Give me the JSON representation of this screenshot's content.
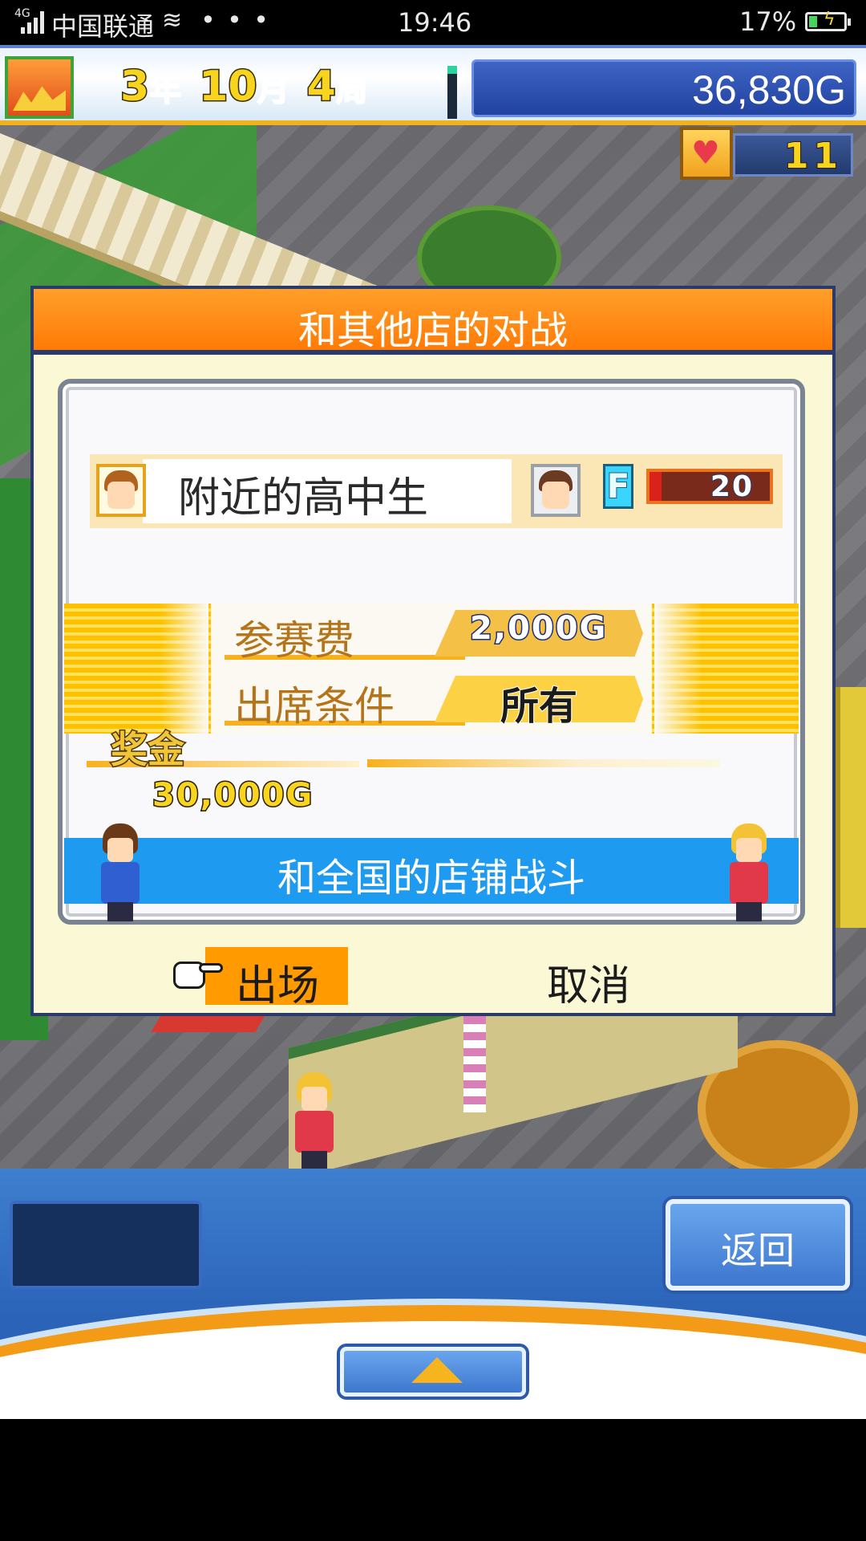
{
  "status_bar": {
    "network": "4G",
    "carrier": "中国联通",
    "more": "• • •",
    "time": "19:46",
    "battery": "17%"
  },
  "hud": {
    "year_num": "3",
    "year_unit": "年",
    "month_num": "10",
    "month_unit": "月",
    "week_num": "4",
    "week_unit": "周",
    "money": "36,830G",
    "hearts": "11"
  },
  "dialog": {
    "title": "和其他店的对战",
    "opponent_name": "附近的高中生",
    "rank": "F",
    "level": "20",
    "fee_label": "参赛费",
    "fee_value": "2,000G",
    "condition_label": "出席条件",
    "condition_value": "所有",
    "prize_label": "奖金",
    "prize_value": "30,000G",
    "battle_banner": "和全国的店铺战斗",
    "confirm_label": "出场",
    "cancel_label": "取消"
  },
  "bottom_panel": {
    "back_label": "返回"
  },
  "colors": {
    "title_orange": "#ff8a10",
    "dialog_bg": "#fbf8d6",
    "banner_blue": "#1e9af0",
    "money_blue": "#2a4fb0"
  }
}
